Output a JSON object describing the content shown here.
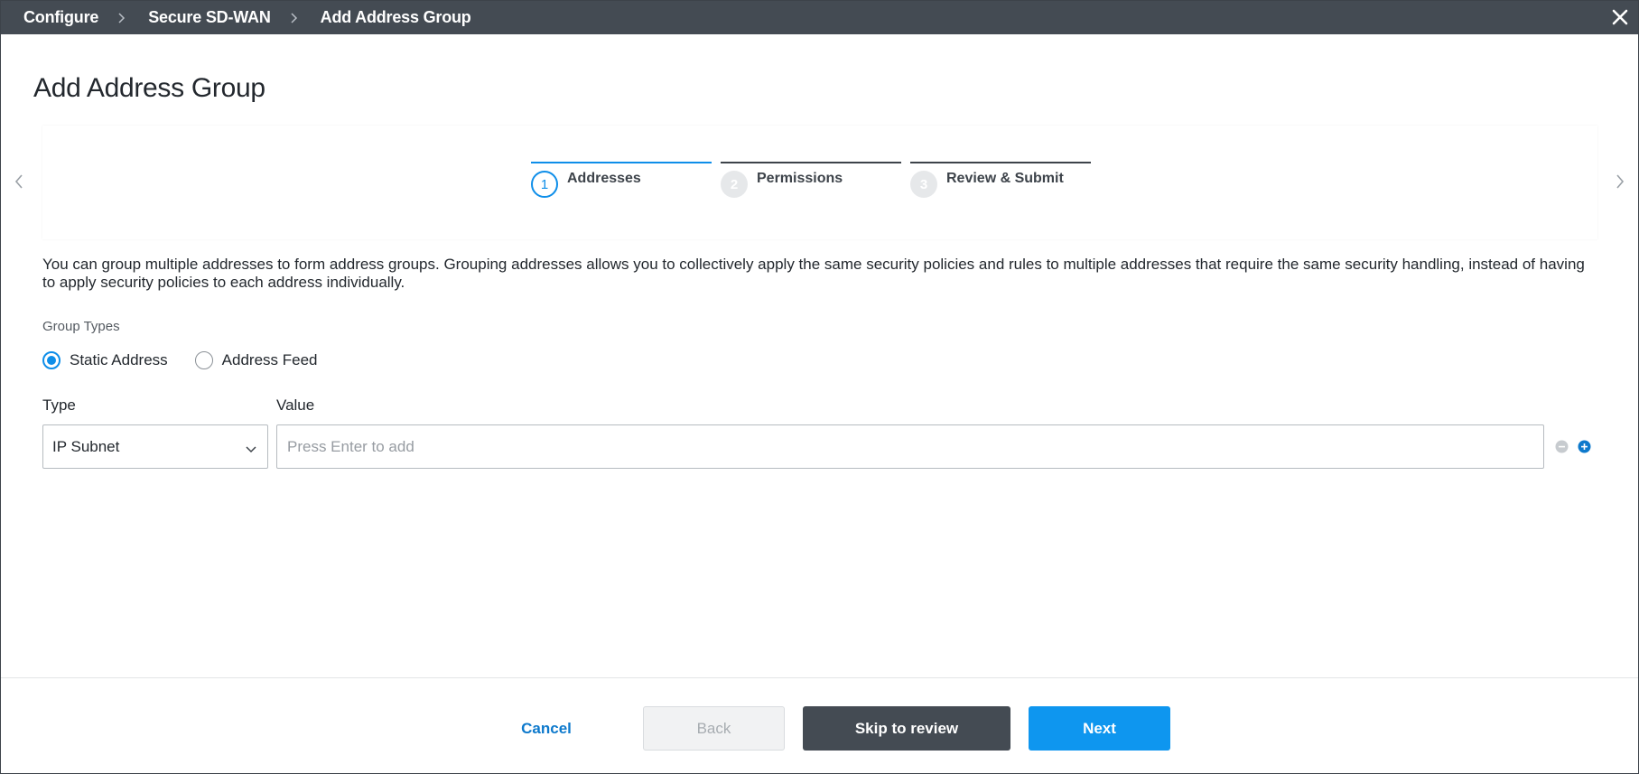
{
  "topbar": {
    "breadcrumbs": [
      "Configure",
      "Secure SD-WAN",
      "Add Address Group"
    ],
    "close_icon": "close-icon"
  },
  "page": {
    "title": "Add Address Group"
  },
  "stepper": {
    "steps": [
      {
        "num": "1",
        "label": "Addresses",
        "state": "active"
      },
      {
        "num": "2",
        "label": "Permissions",
        "state": "inactive"
      },
      {
        "num": "3",
        "label": "Review & Submit",
        "state": "inactive"
      }
    ],
    "nav_icons": [
      "chevron-left-icon",
      "chevron-right-icon"
    ]
  },
  "description": "You can group multiple addresses to form address groups. Grouping addresses allows you to collectively apply the same security policies and rules to multiple addresses that require the same security handling, instead of having to apply security policies to each address individually.",
  "group_types": {
    "label": "Group Types",
    "options": [
      {
        "label": "Static Address",
        "checked": true
      },
      {
        "label": "Address Feed",
        "checked": false
      }
    ]
  },
  "fields": {
    "type_label": "Type",
    "type_value": "IP Subnet",
    "value_label": "Value",
    "value_placeholder": "Press Enter to add",
    "value_current": ""
  },
  "footer": {
    "cancel": "Cancel",
    "back": "Back",
    "skip": "Skip to review",
    "next": "Next"
  },
  "colors": {
    "accent": "#0e96ef",
    "topbar": "#444b53",
    "link": "#0d79cc"
  }
}
